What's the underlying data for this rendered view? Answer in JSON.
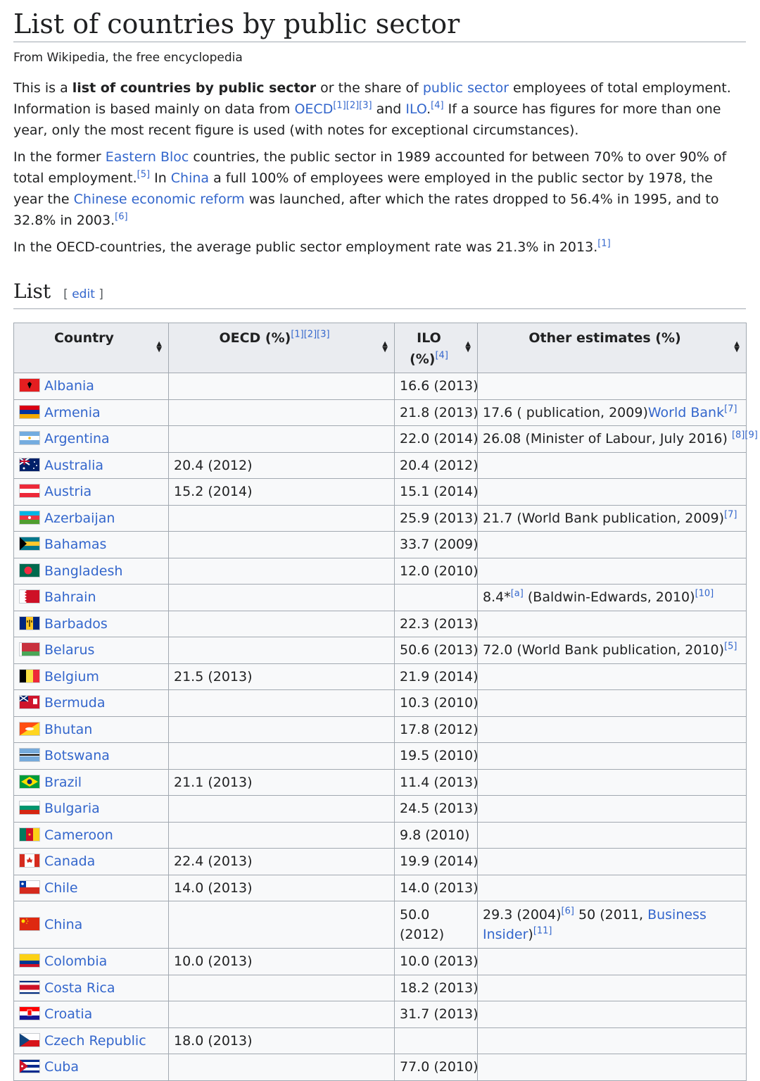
{
  "title": "List of countries by public sector",
  "tagline": "From Wikipedia, the free encyclopedia",
  "intro": {
    "p1": {
      "a": "This is a ",
      "bold": "list of countries by public sector",
      "b": " or the share of ",
      "link_public_sector": "public sector",
      "c": " employees of total employment. Information is based mainly on data from ",
      "link_oecd": "OECD",
      "refs_oecd": "[1][2][3]",
      "d": " and ",
      "link_ilo": "ILO",
      "e": ".",
      "ref_ilo": "[4]",
      "f": " If a source has figures for more than one year, only the most recent figure is used (with notes for exceptional circumstances)."
    },
    "p2": {
      "a": "In the former ",
      "link_eastern_bloc": "Eastern Bloc",
      "b": " countries, the public sector in 1989 accounted for between 70% to over 90% of total employment.",
      "ref5": "[5]",
      "c": " In ",
      "link_china": "China",
      "d": " a full 100% of employees were employed in the public sector by 1978, the year the ",
      "link_reform": "Chinese economic reform",
      "e": " was launched, after which the rates dropped to 56.4% in 1995, and to 32.8% in 2003.",
      "ref6": "[6]"
    },
    "p3": {
      "a": "In the OECD-countries, the average public sector employment rate was 21.3% in 2013.",
      "ref1": "[1]"
    }
  },
  "section": {
    "heading": "List",
    "edit_open": "[ ",
    "edit_label": "edit",
    "edit_close": " ]"
  },
  "table": {
    "headers": {
      "country": "Country",
      "oecd": "OECD (%)",
      "oecd_refs": "[1][2][3]",
      "ilo_a": "ILO",
      "ilo_b": "(%)",
      "ilo_ref": "[4]",
      "other": "Other estimates (%)"
    },
    "rows": [
      {
        "country": "Albania",
        "oecd": "",
        "ilo": "16.6 (2013)"
      },
      {
        "country": "Armenia",
        "oecd": "",
        "ilo": "21.8 (2013)",
        "o1": "17.6 (",
        "olink": "World Bank",
        "o2": " publication, 2009)",
        "oref": "[7]"
      },
      {
        "country": "Argentina",
        "oecd": "",
        "ilo": "22.0 (2014)",
        "o1": "26.08 (Minister of Labour, July 2016) ",
        "oref": "[8][9]"
      },
      {
        "country": "Australia",
        "oecd": "20.4 (2012)",
        "ilo": "20.4 (2012)"
      },
      {
        "country": "Austria",
        "oecd": "15.2 (2014)",
        "ilo": "15.1 (2014)"
      },
      {
        "country": "Azerbaijan",
        "oecd": "",
        "ilo": "25.9 (2013)",
        "o1": "21.7 (World Bank publication, 2009)",
        "oref": "[7]"
      },
      {
        "country": "Bahamas",
        "oecd": "",
        "ilo": "33.7 (2009)"
      },
      {
        "country": "Bangladesh",
        "oecd": "",
        "ilo": "12.0 (2010)"
      },
      {
        "country": "Bahrain",
        "oecd": "",
        "ilo": "",
        "o1": "8.4*",
        "oref_a": "[a]",
        "o2": " (Baldwin-Edwards, 2010)",
        "oref": "[10]"
      },
      {
        "country": "Barbados",
        "oecd": "",
        "ilo": "22.3 (2013)"
      },
      {
        "country": "Belarus",
        "oecd": "",
        "ilo": "50.6 (2013)",
        "o1": "72.0 (World Bank publication, 2010)",
        "oref": "[5]"
      },
      {
        "country": "Belgium",
        "oecd": "21.5 (2013)",
        "ilo": "21.9 (2014)"
      },
      {
        "country": "Bermuda",
        "oecd": "",
        "ilo": "10.3 (2010)"
      },
      {
        "country": "Bhutan",
        "oecd": "",
        "ilo": "17.8 (2012)"
      },
      {
        "country": "Botswana",
        "oecd": "",
        "ilo": "19.5 (2010)"
      },
      {
        "country": "Brazil",
        "oecd": "21.1 (2013)",
        "ilo": "11.4 (2013)"
      },
      {
        "country": "Bulgaria",
        "oecd": "",
        "ilo": "24.5 (2013)"
      },
      {
        "country": "Cameroon",
        "oecd": "",
        "ilo": "9.8 (2010)"
      },
      {
        "country": "Canada",
        "oecd": "22.4 (2013)",
        "ilo": "19.9 (2014)"
      },
      {
        "country": "Chile",
        "oecd": "14.0 (2013)",
        "ilo": "14.0 (2013)"
      },
      {
        "country": "China",
        "oecd": "",
        "ilo": "50.0 (2012)",
        "o1": "29.3 (2004)",
        "oref_a": "[6]",
        "o2": " 50 (2011, ",
        "olink": "Business Insider",
        "o3": ")",
        "oref": "[11]",
        "tall": true
      },
      {
        "country": "Colombia",
        "oecd": "10.0 (2013)",
        "ilo": "10.0 (2013)"
      },
      {
        "country": "Costa Rica",
        "oecd": "",
        "ilo": "18.2 (2013)"
      },
      {
        "country": "Croatia",
        "oecd": "",
        "ilo": "31.7 (2013)"
      },
      {
        "country": "Czech Republic",
        "oecd": "18.0 (2013)",
        "ilo": ""
      },
      {
        "country": "Cuba",
        "oecd": "",
        "ilo": "77.0 (2010)"
      }
    ]
  },
  "flags": {
    "Albania": "flag-albania-icon",
    "Armenia": "flag-armenia-icon",
    "Argentina": "flag-argentina-icon",
    "Australia": "flag-australia-icon",
    "Austria": "flag-austria-icon",
    "Azerbaijan": "flag-azerbaijan-icon",
    "Bahamas": "flag-bahamas-icon",
    "Bangladesh": "flag-bangladesh-icon",
    "Bahrain": "flag-bahrain-icon",
    "Barbados": "flag-barbados-icon",
    "Belarus": "flag-belarus-icon",
    "Belgium": "flag-belgium-icon",
    "Bermuda": "flag-bermuda-icon",
    "Bhutan": "flag-bhutan-icon",
    "Botswana": "flag-botswana-icon",
    "Brazil": "flag-brazil-icon",
    "Bulgaria": "flag-bulgaria-icon",
    "Cameroon": "flag-cameroon-icon",
    "Canada": "flag-canada-icon",
    "Chile": "flag-chile-icon",
    "China": "flag-china-icon",
    "Colombia": "flag-colombia-icon",
    "Costa Rica": "flag-costa-rica-icon",
    "Croatia": "flag-croatia-icon",
    "Czech Republic": "flag-czech-republic-icon",
    "Cuba": "flag-cuba-icon"
  },
  "colors": {
    "link": "#3366cc",
    "border": "#a2a9b1",
    "header_bg": "#eaecf0",
    "cell_bg": "#f8f9fa"
  }
}
